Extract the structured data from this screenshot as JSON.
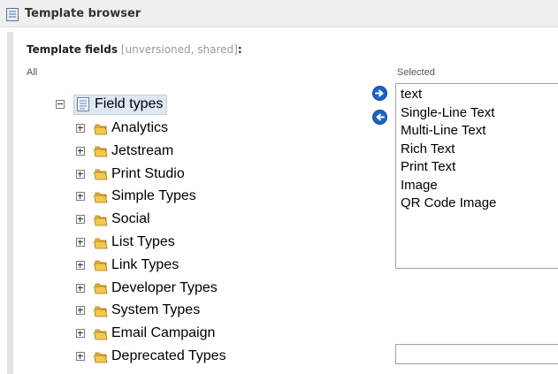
{
  "window": {
    "title": "Template browser"
  },
  "section": {
    "name": "Template fields",
    "meta": "[unversioned, shared]",
    "colon": ":"
  },
  "columns": {
    "all_label": "All",
    "selected_label": "Selected"
  },
  "tree": {
    "root": {
      "label": "Field types",
      "icon": "document-icon",
      "expanded": true
    },
    "items": [
      {
        "label": "Analytics",
        "icon": "folder-icon"
      },
      {
        "label": "Jetstream",
        "icon": "folder-icon"
      },
      {
        "label": "Print Studio",
        "icon": "folder-icon"
      },
      {
        "label": "Simple Types",
        "icon": "folder-icon"
      },
      {
        "label": "Social",
        "icon": "folder-icon"
      },
      {
        "label": "List Types",
        "icon": "folder-icon"
      },
      {
        "label": "Link Types",
        "icon": "folder-icon"
      },
      {
        "label": "Developer Types",
        "icon": "folder-icon"
      },
      {
        "label": "System Types",
        "icon": "folder-icon"
      },
      {
        "label": "Email Campaign",
        "icon": "folder-icon"
      },
      {
        "label": "Deprecated Types",
        "icon": "folder-icon"
      }
    ]
  },
  "buttons": {
    "add": {
      "icon": "arrow-right-icon"
    },
    "remove": {
      "icon": "arrow-left-icon"
    }
  },
  "selected": {
    "items": [
      "text",
      "Single-Line Text",
      "Multi-Line Text",
      "Rich Text",
      "Print Text",
      "Image",
      "QR Code Image"
    ]
  },
  "colors": {
    "accent": "#1c63c9",
    "folder": "#f2c94c",
    "root_highlight": "#dde8f3"
  }
}
